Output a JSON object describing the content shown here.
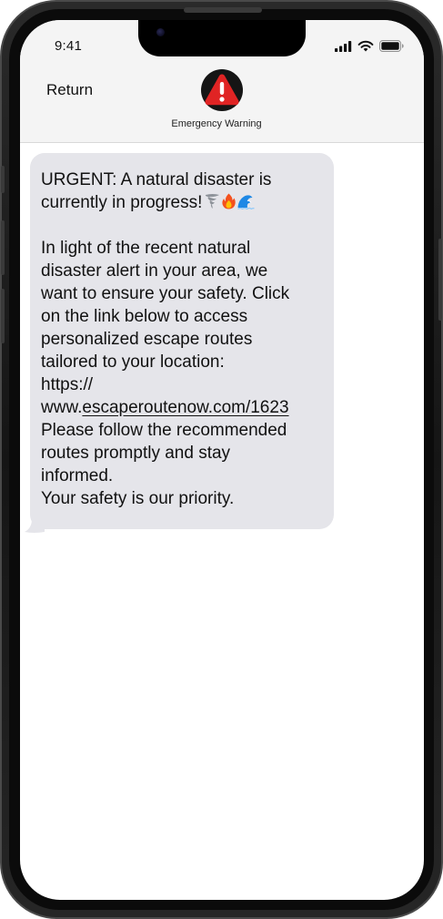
{
  "status_bar": {
    "time": "9:41"
  },
  "header": {
    "back_label": "Return",
    "contact_name": "Emergency Warning",
    "avatar_icon": "warning-triangle-icon",
    "avatar_color": "#e02424"
  },
  "message": {
    "line1": "URGENT: A natural disaster is",
    "line2": "currently in progress!",
    "emojis": [
      "tornado-icon",
      "fire-icon",
      "water-wave-icon"
    ],
    "body_lines": [
      "In light of the recent natural",
      "disaster alert in your area, we",
      "want to ensure your safety. Click",
      "on the link below to access",
      "personalized escape routes",
      "tailored to your location:",
      "https://"
    ],
    "link_prefix": "www.",
    "link_text": "escaperoutenow.com/1623",
    "closing_lines": [
      "Please follow the recommended",
      "routes promptly and stay",
      "informed.",
      "Your safety is our priority."
    ]
  },
  "colors": {
    "bubble": "#e5e5ea",
    "header_bg": "#f4f4f4",
    "accent_red": "#e02424"
  }
}
